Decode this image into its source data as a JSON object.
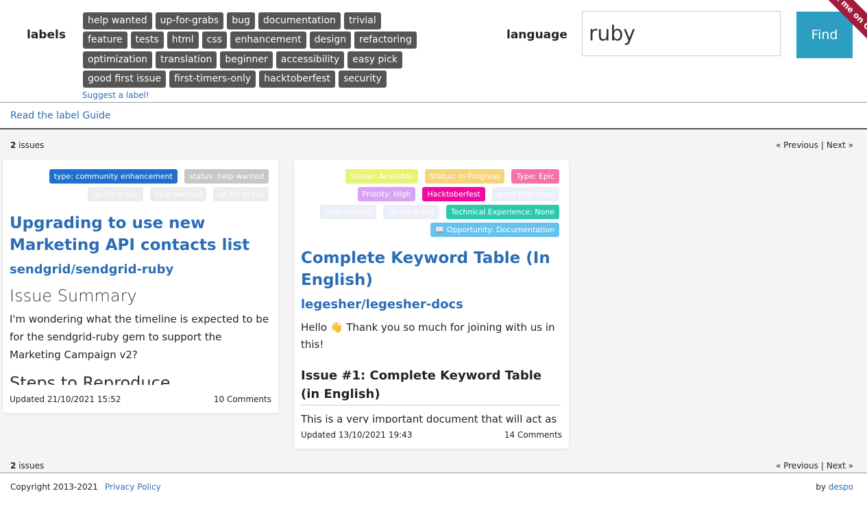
{
  "header": {
    "labels_title": "labels",
    "label_rows": [
      [
        {
          "text": "help wanted",
          "color": "#228b22"
        },
        {
          "text": "up-for-grabs",
          "color": "#2b9ec1"
        },
        {
          "text": "bug",
          "color": "#555555"
        },
        {
          "text": "documentation",
          "color": "#555555"
        },
        {
          "text": "trivial",
          "color": "#555555"
        }
      ],
      [
        {
          "text": "feature",
          "color": "#555555"
        },
        {
          "text": "tests",
          "color": "#555555"
        },
        {
          "text": "html",
          "color": "#555555"
        },
        {
          "text": "css",
          "color": "#555555"
        },
        {
          "text": "enhancement",
          "color": "#555555"
        },
        {
          "text": "design",
          "color": "#555555"
        },
        {
          "text": "refactoring",
          "color": "#555555"
        }
      ],
      [
        {
          "text": "optimization",
          "color": "#555555"
        },
        {
          "text": "translation",
          "color": "#555555"
        },
        {
          "text": "beginner",
          "color": "#555555"
        },
        {
          "text": "accessibility",
          "color": "#555555"
        },
        {
          "text": "easy pick",
          "color": "#555555"
        }
      ],
      [
        {
          "text": "good first issue",
          "color": "#555555"
        },
        {
          "text": "first-timers-only",
          "color": "#555555"
        },
        {
          "text": "hacktoberfest",
          "color": "#555555"
        },
        {
          "text": "security",
          "color": "#555555"
        }
      ]
    ],
    "suggest_label": "Suggest a label!",
    "language_title": "language",
    "language_value": "ruby",
    "find_label": "Find",
    "ribbon_text": "Fork me on GitHub"
  },
  "guide": {
    "link": "Read the label Guide"
  },
  "pagination": {
    "count": "2",
    "count_suffix": " issues",
    "previous": "« Previous",
    "separator": "|",
    "next": "Next »"
  },
  "issues": [
    {
      "label_rows": [
        [
          {
            "text": "type: community enhancement",
            "color": "#1f6fd1",
            "fg": "#ffffff"
          },
          {
            "text": "status: help wanted",
            "color": "#c7c7c7",
            "fg": "#ffffff"
          }
        ],
        [
          {
            "text": "up-for-grabs",
            "color": "#ececec",
            "fg": "#ffffff"
          },
          {
            "text": "help wanted",
            "color": "#ececec",
            "fg": "#ffffff"
          },
          {
            "text": "up for grabs",
            "color": "#ececec",
            "fg": "#ffffff"
          }
        ]
      ],
      "title": "Upgrading to use new Marketing API contacts list",
      "repo": "sendgrid/sendgrid-ruby",
      "summary_heading": "Issue Summary",
      "body": "I'm wondering what the timeline is expected to be for the sendgrid-ruby gem to support the Marketing Campaign v2?",
      "cut_heading": "Steps to Reproduce",
      "updated": "Updated 21/10/2021 15:52",
      "comments": "10 Comments"
    },
    {
      "label_rows": [
        [
          {
            "text": "Status: Available",
            "color": "#e8f46f",
            "fg": "#ffffff"
          },
          {
            "text": "Status: In Progress",
            "color": "#f7d47a",
            "fg": "#ffffff"
          },
          {
            "text": "Type: Epic",
            "color": "#f472a7",
            "fg": "#ffffff"
          }
        ],
        [
          {
            "text": "Priority: High",
            "color": "#d7a3f5",
            "fg": "#ffffff"
          },
          {
            "text": "Hacktoberfest",
            "color": "#f00aa0",
            "fg": "#ffffff"
          },
          {
            "text": "good first issue",
            "color": "#eceef9",
            "fg": "#ffffff"
          }
        ],
        [
          {
            "text": "help wanted",
            "color": "#eceef9",
            "fg": "#ffffff"
          },
          {
            "text": "up-for-grabs",
            "color": "#eceef9",
            "fg": "#ffffff"
          },
          {
            "text": "Technical Experience: None",
            "color": "#2dc9ac",
            "fg": "#ffffff"
          }
        ],
        [
          {
            "text": "📖 Opportunity: Documentation",
            "color": "#67c3ee",
            "fg": "#ffffff"
          }
        ]
      ],
      "title": "Complete Keyword Table (In English)",
      "repo": "legesher/legesher-docs",
      "body": "Hello 👋 Thank you so much for joining with us in this!",
      "body_heading": "Issue #1: Complete Keyword Table (in English)",
      "body_more": "This is a very important document that will act as",
      "updated": "Updated 13/10/2021 19:43",
      "comments": "14 Comments"
    }
  ],
  "footer": {
    "copyright": "Copyright 2013-2021",
    "privacy": "Privacy Policy",
    "by_prefix": "by ",
    "author": "despo"
  }
}
